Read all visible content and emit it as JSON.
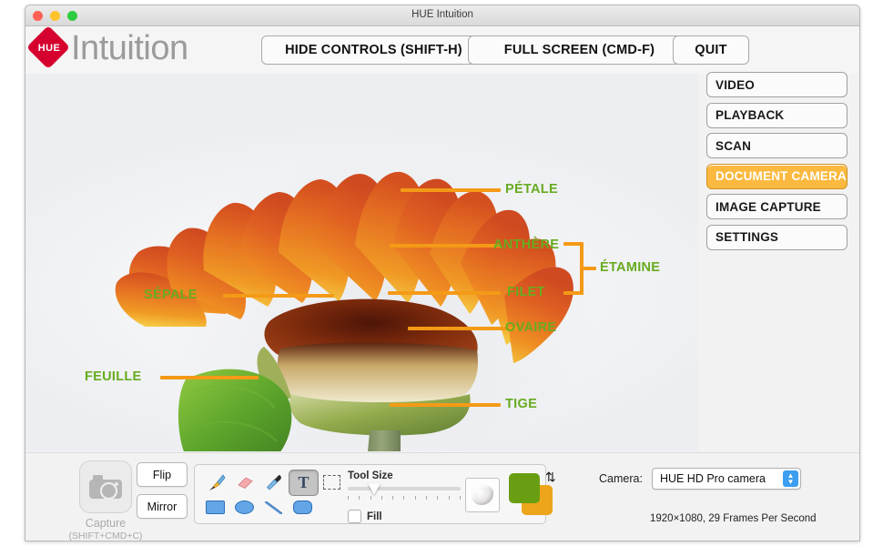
{
  "window": {
    "title": "HUE Intuition",
    "controls": {
      "close": "close-button",
      "minimize": "minimize-button",
      "zoom": "zoom-button"
    }
  },
  "brand": {
    "badge_text": "HUE",
    "name": "Intuition"
  },
  "header": {
    "hide_controls_label": "HIDE CONTROLS (SHIFT-H)",
    "full_screen_label": "FULL SCREEN (CMD-F)",
    "quit_label": "QUIT"
  },
  "sidebar": {
    "items": [
      {
        "label": "VIDEO",
        "active": false
      },
      {
        "label": "PLAYBACK",
        "active": false
      },
      {
        "label": "SCAN",
        "active": false
      },
      {
        "label": "DOCUMENT CAMERA",
        "active": true
      },
      {
        "label": "IMAGE CAPTURE",
        "active": false
      },
      {
        "label": "SETTINGS",
        "active": false
      }
    ],
    "active_color": "#fbb93f"
  },
  "canvas": {
    "subject": "cross-sectioned orange gerbera flower on white background",
    "annotation_text_color": "#67ab20",
    "annotation_line_color": "#f49a16",
    "annotations": [
      {
        "label": "PÉTALE"
      },
      {
        "label": "ANTHÈRE"
      },
      {
        "label": "FILET"
      },
      {
        "label": "ÉTAMINE"
      },
      {
        "label": "SÉPALE"
      },
      {
        "label": "OVAIRE"
      },
      {
        "label": "FEUILLE"
      },
      {
        "label": "TIGE"
      }
    ]
  },
  "bottombar": {
    "capture": {
      "label": "Capture",
      "shortcut": "(SHIFT+CMD+C)",
      "icon": "camera-icon",
      "disabled": true
    },
    "flip_label": "Flip",
    "mirror_label": "Mirror",
    "tools": [
      {
        "name": "brush-tool",
        "icon": "paintbrush-icon",
        "selected": false
      },
      {
        "name": "eraser-tool",
        "icon": "eraser-icon",
        "selected": false
      },
      {
        "name": "eyedropper-tool",
        "icon": "eyedropper-icon",
        "selected": false
      },
      {
        "name": "text-tool",
        "icon": "text-T-icon",
        "label": "T",
        "selected": true
      },
      {
        "name": "select-tool",
        "icon": "marquee-icon",
        "selected": false
      },
      {
        "name": "rectangle-tool",
        "icon": "rectangle-icon",
        "selected": false
      },
      {
        "name": "ellipse-tool",
        "icon": "ellipse-icon",
        "selected": false
      },
      {
        "name": "line-tool",
        "icon": "line-icon",
        "selected": false
      },
      {
        "name": "rounded-rectangle-tool",
        "icon": "rounded-rectangle-icon",
        "selected": false
      }
    ],
    "tool_size_label": "Tool Size",
    "tool_size_value": 2,
    "tool_size_ticks": 11,
    "fill_label": "Fill",
    "fill_checked": false,
    "texture_button": "texture-icon",
    "foreground_color": "#6a9e12",
    "background_color": "#eda51c",
    "swap_icon": "swap-colors-icon"
  },
  "camera": {
    "caption": "Camera:",
    "selected": "HUE HD Pro camera",
    "resolution": "1920×1080, 29 Frames Per Second"
  }
}
